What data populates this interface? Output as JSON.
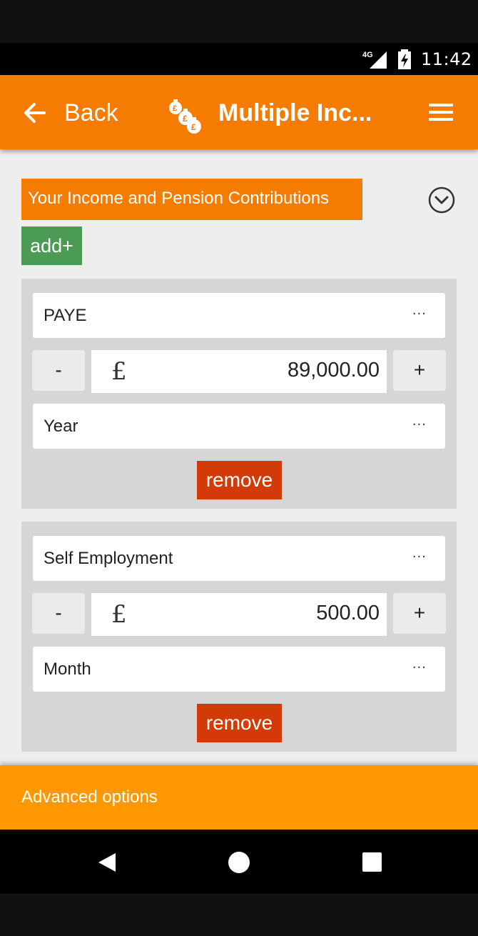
{
  "status_bar": {
    "network": "4G",
    "time": "11:42"
  },
  "app_bar": {
    "back_label": "Back",
    "title": "Multiple Inc...",
    "app_icon": "money-bags-icon",
    "menu_icon": "hamburger-menu-icon"
  },
  "section": {
    "title": "Your Income and Pension Contributions",
    "collapse_icon": "chevron-down-circle-icon",
    "add_label": "add+"
  },
  "incomes": [
    {
      "type": "PAYE",
      "currency": "£",
      "amount": "89,000.00",
      "period": "Year",
      "minus_label": "-",
      "plus_label": "+",
      "more": "···",
      "remove_label": "remove"
    },
    {
      "type": "Self Employment",
      "currency": "£",
      "amount": "500.00",
      "period": "Month",
      "minus_label": "-",
      "plus_label": "+",
      "more": "···",
      "remove_label": "remove"
    }
  ],
  "footer": {
    "advanced_label": "Advanced options"
  },
  "colors": {
    "app_bar": "#f57c00",
    "add_button": "#4b9b55",
    "remove_button": "#d23b07",
    "advanced_bar": "#ff9800"
  }
}
